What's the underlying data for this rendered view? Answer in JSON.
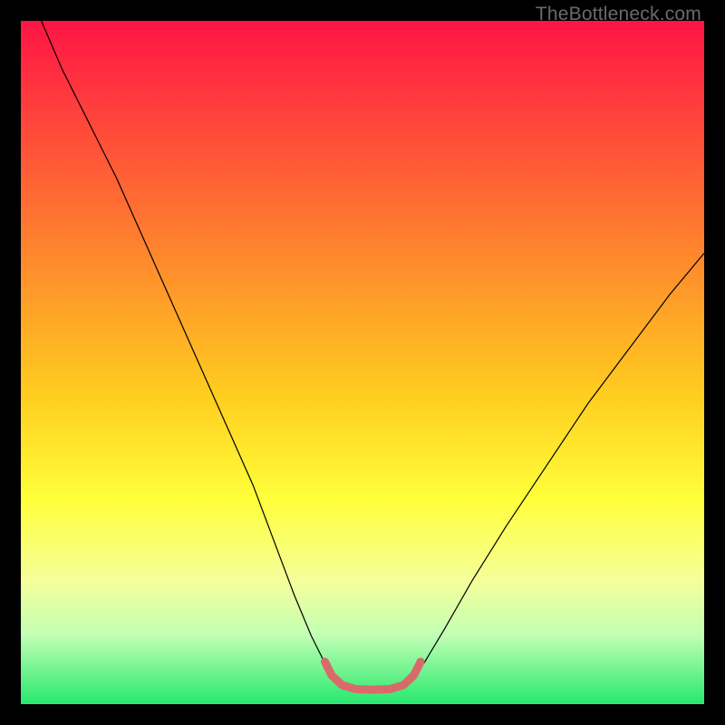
{
  "watermark": "TheBottleneck.com",
  "chart_data": {
    "type": "line",
    "title": "",
    "xlabel": "",
    "ylabel": "",
    "xlim": [
      0,
      100
    ],
    "ylim": [
      0,
      100
    ],
    "grid": false,
    "legend": false,
    "gradient": {
      "colors": [
        "#FF1445",
        "#FF7830",
        "#FFCE1F",
        "#FFFF3A",
        "#F5FF9A",
        "#C1FFB4",
        "#26E86E"
      ],
      "stops": [
        0,
        30,
        55,
        70,
        82,
        90,
        100
      ]
    },
    "series": [
      {
        "name": "left-arm",
        "color": "#000000",
        "width": 1.2,
        "x": [
          3,
          6,
          10,
          14,
          18,
          22,
          26,
          30,
          34,
          37,
          40,
          42.5,
          44.5,
          46
        ],
        "y": [
          100,
          93,
          85,
          77,
          68,
          59,
          50,
          41,
          32,
          24,
          16,
          10,
          6,
          3.5
        ]
      },
      {
        "name": "right-arm",
        "color": "#000000",
        "width": 1.2,
        "x": [
          57,
          59,
          62,
          66,
          71,
          77,
          83,
          89,
          95,
          100
        ],
        "y": [
          3.5,
          6,
          11,
          18,
          26,
          35,
          44,
          52,
          60,
          66
        ]
      },
      {
        "name": "valley-floor",
        "color": "#D96A6A",
        "width": 9,
        "linecap": "round",
        "x": [
          44.5,
          45.5,
          47,
          49,
          51.5,
          54,
          56,
          57.5,
          58.5
        ],
        "y": [
          6.2,
          4.2,
          2.8,
          2.2,
          2.1,
          2.2,
          2.8,
          4.2,
          6.2
        ]
      }
    ]
  }
}
